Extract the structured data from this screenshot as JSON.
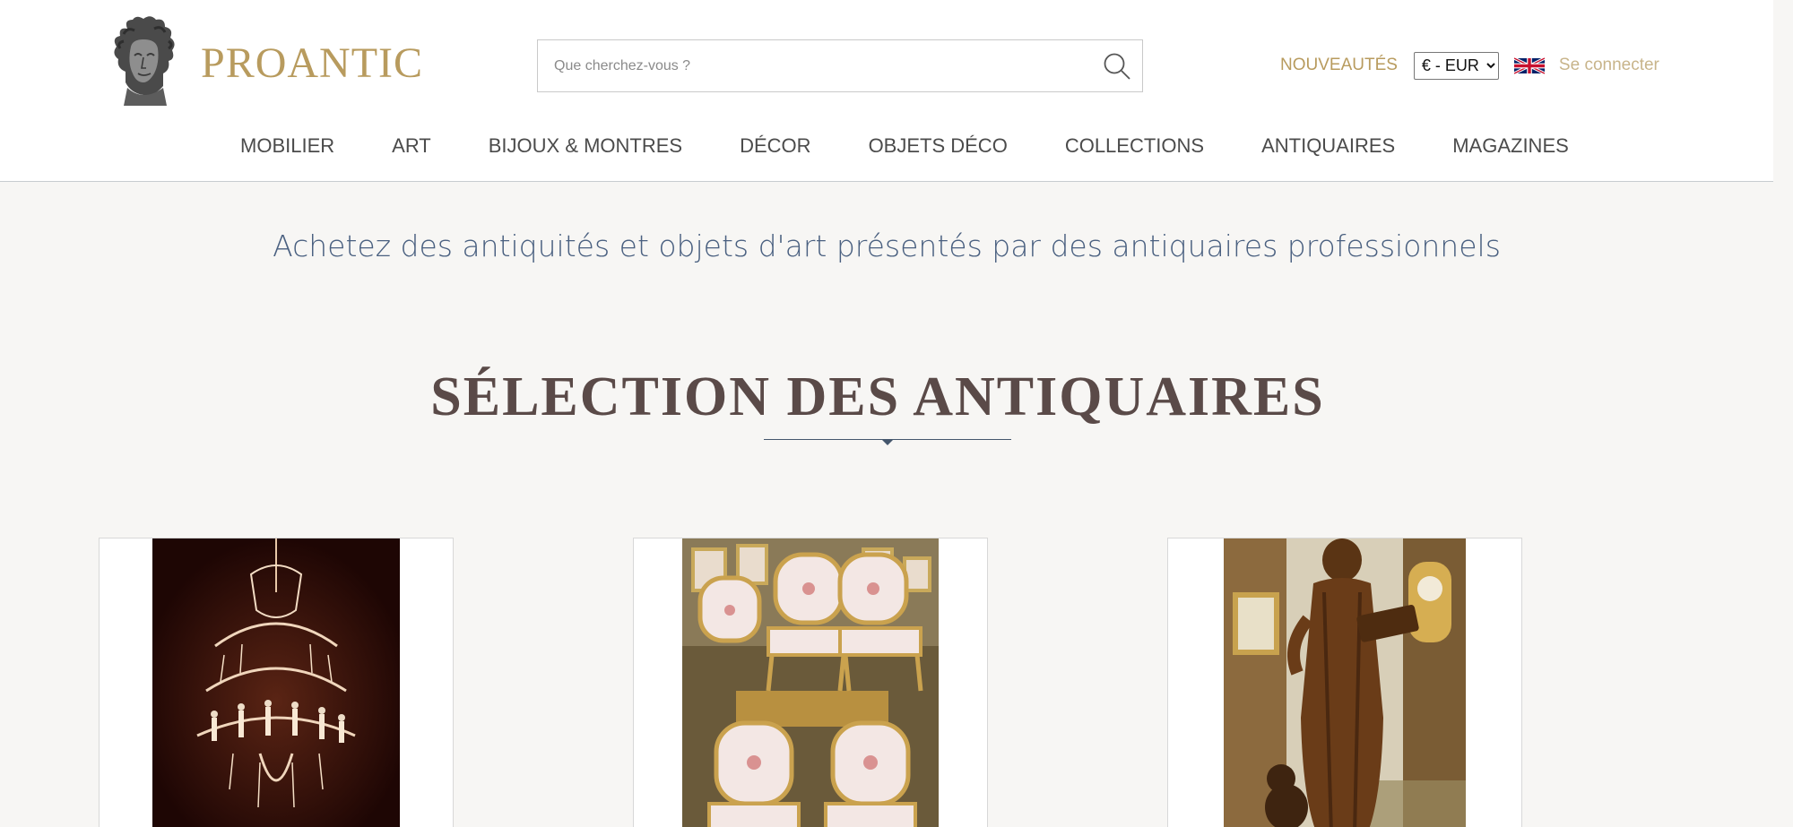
{
  "header": {
    "brand": "PROANTIC",
    "search_placeholder": "Que cherchez-vous ?",
    "nouveautes": "NOUVEAUTÉS",
    "currency": "€ - EUR",
    "language_flag": "uk-flag-icon",
    "login": "Se connecter"
  },
  "nav": {
    "items": [
      "MOBILIER",
      "ART",
      "BIJOUX & MONTRES",
      "DÉCOR",
      "OBJETS DÉCO",
      "COLLECTIONS",
      "ANTIQUAIRES",
      "MAGAZINES"
    ]
  },
  "hero": {
    "tagline": "Achetez des antiquités et objets d'art présentés par des antiquaires professionnels"
  },
  "section": {
    "title": "SÉLECTION DES ANTIQUAIRES"
  },
  "products": [
    {
      "image": "crystal-chandelier-image"
    },
    {
      "image": "gilded-chairs-image"
    },
    {
      "image": "carved-saint-statue-image"
    }
  ],
  "colors": {
    "brand_gold": "#b89b5e",
    "tagline_blue": "#4a6080",
    "title_brown": "#5a4a48",
    "page_bg": "#f7f6f4"
  }
}
